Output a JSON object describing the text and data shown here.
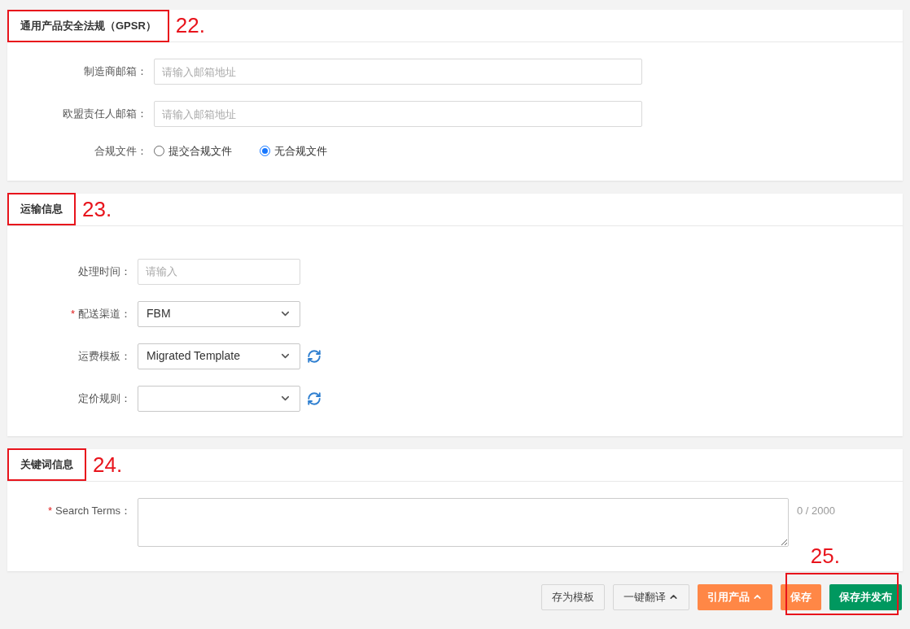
{
  "sections": [
    {
      "title": "通用产品安全法规（GPSR）",
      "annotation": "22.",
      "fields": [
        {
          "kind": "email",
          "label": "制造商邮箱：",
          "placeholder": "请输入邮箱地址"
        },
        {
          "kind": "email",
          "label": "欧盟责任人邮箱：",
          "placeholder": "请输入邮箱地址"
        },
        {
          "kind": "radio",
          "label": "合规文件：",
          "options": [
            {
              "label": "提交合规文件",
              "selected": false
            },
            {
              "label": "无合规文件",
              "selected": true
            }
          ]
        }
      ]
    },
    {
      "title": "运输信息",
      "annotation": "23.",
      "fields": [
        {
          "kind": "text",
          "label": "处理时间：",
          "placeholder": "请输入"
        },
        {
          "kind": "select",
          "label": "配送渠道：",
          "required_mark": "*",
          "value": "FBM",
          "refresh": false
        },
        {
          "kind": "select",
          "label": "运费模板：",
          "value": "Migrated Template",
          "refresh": true
        },
        {
          "kind": "select",
          "label": "定价规则：",
          "refresh": true
        }
      ]
    },
    {
      "title": "关键词信息",
      "annotation": "24.",
      "fields": [
        {
          "kind": "textarea",
          "label": "Search Terms：",
          "required_mark": "*",
          "counter": "0 / 2000"
        }
      ]
    }
  ],
  "footer": {
    "annotation": "25.",
    "buttons": [
      {
        "kind": "plain",
        "label": "存为模板",
        "caret": false
      },
      {
        "kind": "plain",
        "label": "一键翻译",
        "caret": true
      },
      {
        "kind": "orange",
        "label": "引用产品",
        "caret": true
      },
      {
        "kind": "orange",
        "label": "保存",
        "caret": false
      },
      {
        "kind": "green",
        "label": "保存并发布",
        "caret": false
      }
    ]
  }
}
